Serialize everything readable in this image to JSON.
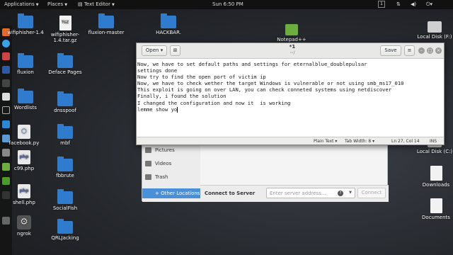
{
  "topbar": {
    "applications": "Applications",
    "places": "Places",
    "app_menu": "Text Editor",
    "clock": "Sun  6:50 PM",
    "workspace": "1"
  },
  "desktop_icons": {
    "wifiphisher": "wifiphisher-1.4",
    "wifiphisher_tgz": "wifiphisher-1.4.tar.gz",
    "tgz_label": "TGZ",
    "fluxion_master": "fluxion-master",
    "hackbar": "HACKBAR.",
    "notepad": "Notepad++",
    "local_disk_top": "Local Disk (F:)",
    "fluxion": "fluxion",
    "deface_pages": "Deface Pages",
    "wordlists": "Wordlists",
    "dnsspoof": "dnsspoof",
    "facebook_py": "facebook.py",
    "mbf": "mbf",
    "c99_php": "c99.php",
    "fbbrute": "fbbrute",
    "shell_php": "shell.php",
    "socialfish": "SocialFish",
    "ngrok": "ngrok",
    "qrljacking": "QRLJacking",
    "local_disk_c": "Local Disk (C:)",
    "downloads": "Downloads",
    "documents": "Documents"
  },
  "files_window": {
    "sidebar": [
      "Pictures",
      "Videos",
      "Trash"
    ],
    "other_locations": "+ Other Locations",
    "connect_to_server": "Connect to Server",
    "server_placeholder": "Enter server address...",
    "connect_button": "Connect"
  },
  "editor": {
    "open_label": "Open",
    "open_arrow": "▾",
    "title": "*1",
    "subtitle": "~/",
    "save_label": "Save",
    "menu_glyph": "≡",
    "lines": [
      "Now, we have to set default paths and settings for eternalblue_doublepulsar",
      "",
      "settings done",
      "Now try to find the open port of victim ip",
      "",
      "Now, we have to check wether the target Windows is vulnerable or not using smb_ms17_010",
      "",
      "This exploit is going on over LAN, you can check conneted systems using netdiscover",
      "",
      "Finally, i found the solution",
      "I changed the configuration and now it  is working",
      "lemme show yo"
    ],
    "status": {
      "language": "Plain Text ▾",
      "tab_width": "Tab Width: 8 ▾",
      "position": "Ln 27, Col 14",
      "mode": "INS"
    }
  },
  "colors": {
    "accent": "#4a90d9",
    "folder": "#2f7ccf"
  }
}
